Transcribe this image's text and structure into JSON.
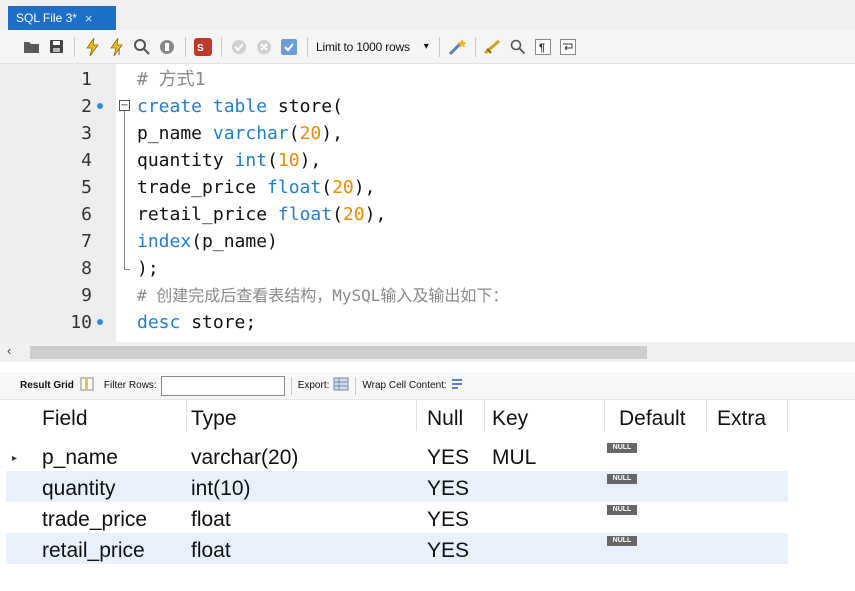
{
  "tab": {
    "title": "SQL File 3*",
    "close": "×"
  },
  "toolbar": {
    "icons": [
      "open-folder-icon",
      "save-icon",
      "execute-icon",
      "execute-current-icon",
      "explain-icon",
      "stop-icon",
      "toggle-autocommit-icon",
      "commit-icon",
      "rollback-icon",
      "output-icon",
      "beautify-icon",
      "find-icon",
      "invisible-chars-icon",
      "wrap-icon"
    ],
    "limit_label": "Limit to 1000 rows",
    "limit_dropdown": "▾"
  },
  "editor": {
    "lines": [
      {
        "n": "1"
      },
      {
        "n": "2"
      },
      {
        "n": "3"
      },
      {
        "n": "4"
      },
      {
        "n": "5"
      },
      {
        "n": "6"
      },
      {
        "n": "7"
      },
      {
        "n": "8"
      },
      {
        "n": "9"
      },
      {
        "n": "10"
      }
    ],
    "code": {
      "l1": "# 方式1",
      "l2a": "create table ",
      "l2b": "store(",
      "l3a": "p_name ",
      "l3b": "varchar",
      "l3c": "(",
      "l3d": "20",
      "l3e": "),",
      "l4a": "quantity ",
      "l4b": "int",
      "l4c": "(",
      "l4d": "10",
      "l4e": "),",
      "l5a": "trade_price ",
      "l5b": "float",
      "l5c": "(",
      "l5d": "20",
      "l5e": "),",
      "l6a": "retail_price ",
      "l6b": "float",
      "l6c": "(",
      "l6d": "20",
      "l6e": "),",
      "l7a": "index",
      "l7b": "(p_name)",
      "l8": ");",
      "l9": "# 创建完成后查看表结构，MySQL输入及输出如下：",
      "l10a": "desc ",
      "l10b": "store;"
    }
  },
  "scroll": {
    "left_arrow": "‹"
  },
  "result_toolbar": {
    "result_grid": "Result Grid",
    "filter_rows": "Filter Rows:",
    "export": "Export:",
    "wrap": "Wrap Cell Content:"
  },
  "grid": {
    "headers": [
      "Field",
      "Type",
      "Null",
      "Key",
      "Default",
      "Extra"
    ],
    "rows": [
      {
        "field": "p_name",
        "type": "varchar(20)",
        "null": "YES",
        "key": "MUL",
        "default": "NULL",
        "extra": ""
      },
      {
        "field": "quantity",
        "type": "int(10)",
        "null": "YES",
        "key": "",
        "default": "NULL",
        "extra": ""
      },
      {
        "field": "trade_price",
        "type": "float",
        "null": "YES",
        "key": "",
        "default": "NULL",
        "extra": ""
      },
      {
        "field": "retail_price",
        "type": "float",
        "null": "YES",
        "key": "",
        "default": "NULL",
        "extra": ""
      }
    ],
    "row_indicator": "▸"
  },
  "colors": {
    "accent": "#1e6fc8",
    "keyword": "#1f7fd6",
    "number": "#f08a00",
    "comment": "#8a8a8a",
    "alt_row": "#e8f0fb"
  }
}
